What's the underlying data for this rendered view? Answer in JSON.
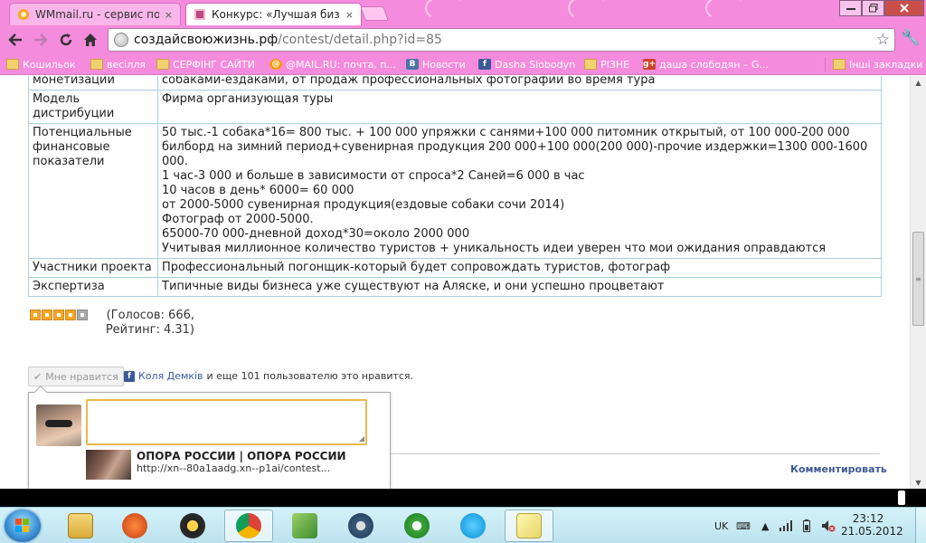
{
  "browser": {
    "tabs": [
      {
        "label": "WMmail.ru - сервис почто",
        "active": false
      },
      {
        "label": "Конкурс: «Лучшая бизнес",
        "active": true
      }
    ],
    "url_host": "создайсвоюжизнь.рф",
    "url_path": "/contest/detail.php?id=85",
    "close_glyph": "×"
  },
  "bookmarks": [
    {
      "label": "Кошильок",
      "icon": "folder-icon"
    },
    {
      "label": "весілля",
      "icon": "folder-icon"
    },
    {
      "label": "СЕРФІНГ САЙТИ",
      "icon": "folder-icon"
    },
    {
      "label": "@MAIL.RU: почта, п...",
      "icon": "mailru-icon"
    },
    {
      "label": "Новости",
      "icon": "vk-icon"
    },
    {
      "label": "Dasha Slobodyn",
      "icon": "facebook-icon"
    },
    {
      "label": "РІЗНЕ",
      "icon": "folder-icon"
    },
    {
      "label": "даша слободян – G...",
      "icon": "gplus-icon"
    },
    {
      "label": "Інші закладки",
      "icon": "folder-icon"
    }
  ],
  "table": [
    {
      "key": "монетизации",
      "lines": [
        "собаками-ездаками, от продаж профессиональных фотографий во время тура"
      ]
    },
    {
      "key": "Модель дистрибуции",
      "lines": [
        "Фирма организующая туры"
      ]
    },
    {
      "key": "Потенциальные финансовые показатели",
      "lines": [
        "50 тыс.-1 собака*16= 800 тыс. + 100 000 упряжки с санями+100 000 питомник открытый, от 100 000-200 000 билборд на зимний период+сувенирная продукция 200 000+100 000(200 000)-прочие издержки=1300 000-1600 000.",
        "1 час-3 000 и больше в зависимости от спроса*2 Саней=6 000 в час",
        "10 часов в день* 6000= 60 000",
        "от 2000-5000 сувенирная продукция(ездовые собаки сочи 2014)",
        "Фотограф от 2000-5000.",
        "65000-70 000-дневной доход*30=около 2000 000",
        "Учитывая миллионное количество туристов + уникальность идеи уверен что мои ожидания оправдаются"
      ]
    },
    {
      "key": "Участники проекта",
      "lines": [
        "Профессиональный погонщик-который будет сопровождать туристов, фотограф"
      ]
    },
    {
      "key": "Экспертиза",
      "lines": [
        "Типичные виды бизнеса уже существуют на Аляске, и они успешно процветают"
      ]
    }
  ],
  "rating": {
    "stars_filled": 4,
    "stars_total": 5,
    "votes_text": "(Голосов: 666, Рейтинг: 4.31)"
  },
  "like": {
    "button_label": "Мне нравится",
    "friend_name": "Коля Демків",
    "rest_text": "и еще 101 пользователю это нравится."
  },
  "comment": {
    "share_title": "ОПОРА РОССИИ | ОПОРА РОССИИ",
    "share_url": "http://xn--80a1aadg.xn--p1ai/contest...",
    "comment_link": "Комментировать"
  },
  "taskbar": {
    "apps": [
      "explorer-icon",
      "ccleaner-icon",
      "aimp-icon",
      "chrome-icon",
      "app-green-icon",
      "app-gear-icon",
      "utorrent-icon",
      "skype-icon",
      "notes-icon"
    ],
    "language": "UK",
    "time": "23:12",
    "date": "21.05.2012"
  }
}
